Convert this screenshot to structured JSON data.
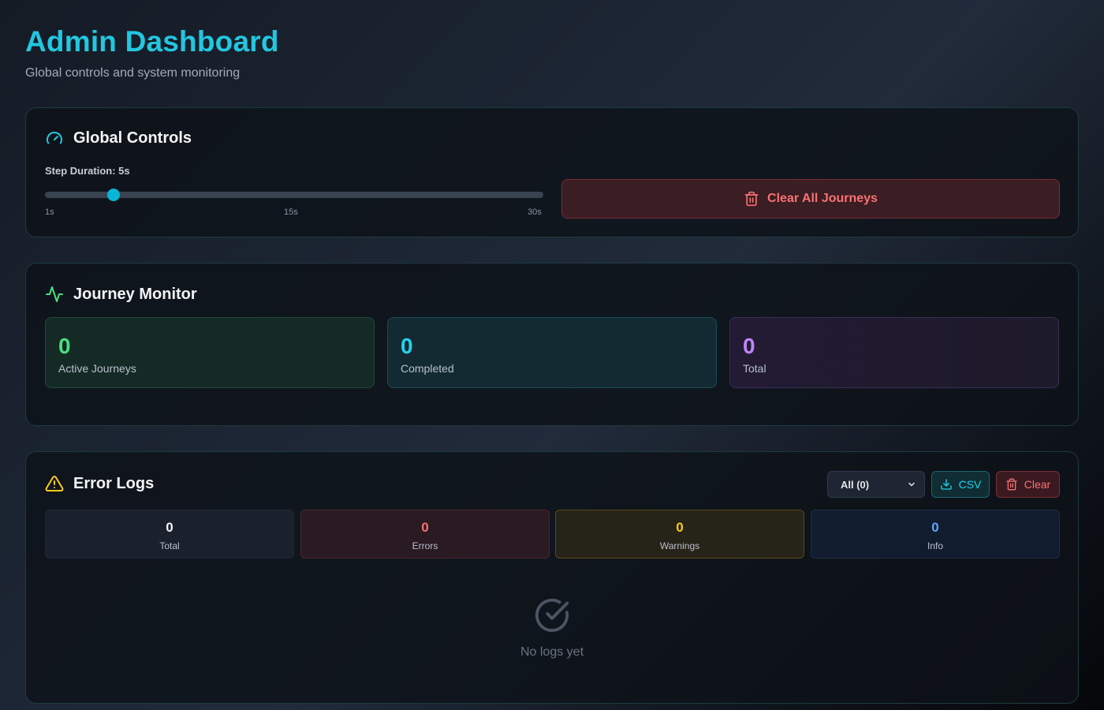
{
  "header": {
    "title": "Admin Dashboard",
    "subtitle": "Global controls and system monitoring"
  },
  "global_controls": {
    "title": "Global Controls",
    "icon": "gauge-icon",
    "step_label": "Step Duration: 5s",
    "slider": {
      "value": 5,
      "min": 1,
      "max": 30
    },
    "ticks": [
      "1s",
      "15s",
      "30s"
    ],
    "clear_all_label": "Clear All Journeys"
  },
  "journey_monitor": {
    "title": "Journey Monitor",
    "icon": "activity-icon",
    "stats": {
      "active": {
        "value": "0",
        "label": "Active Journeys"
      },
      "completed": {
        "value": "0",
        "label": "Completed"
      },
      "total": {
        "value": "0",
        "label": "Total"
      }
    }
  },
  "error_logs": {
    "title": "Error Logs",
    "icon": "warning-icon",
    "filter_selected": "All (0)",
    "csv_label": "CSV",
    "clear_label": "Clear",
    "counts": {
      "total": {
        "value": "0",
        "label": "Total"
      },
      "errors": {
        "value": "0",
        "label": "Errors"
      },
      "warnings": {
        "value": "0",
        "label": "Warnings"
      },
      "info": {
        "value": "0",
        "label": "Info"
      }
    },
    "empty_text": "No logs yet"
  },
  "colors": {
    "accent": "#22c7e0",
    "success": "#4ade80",
    "danger": "#f87171",
    "warning": "#facc15",
    "info": "#60a5fa",
    "purple": "#c084fc"
  }
}
